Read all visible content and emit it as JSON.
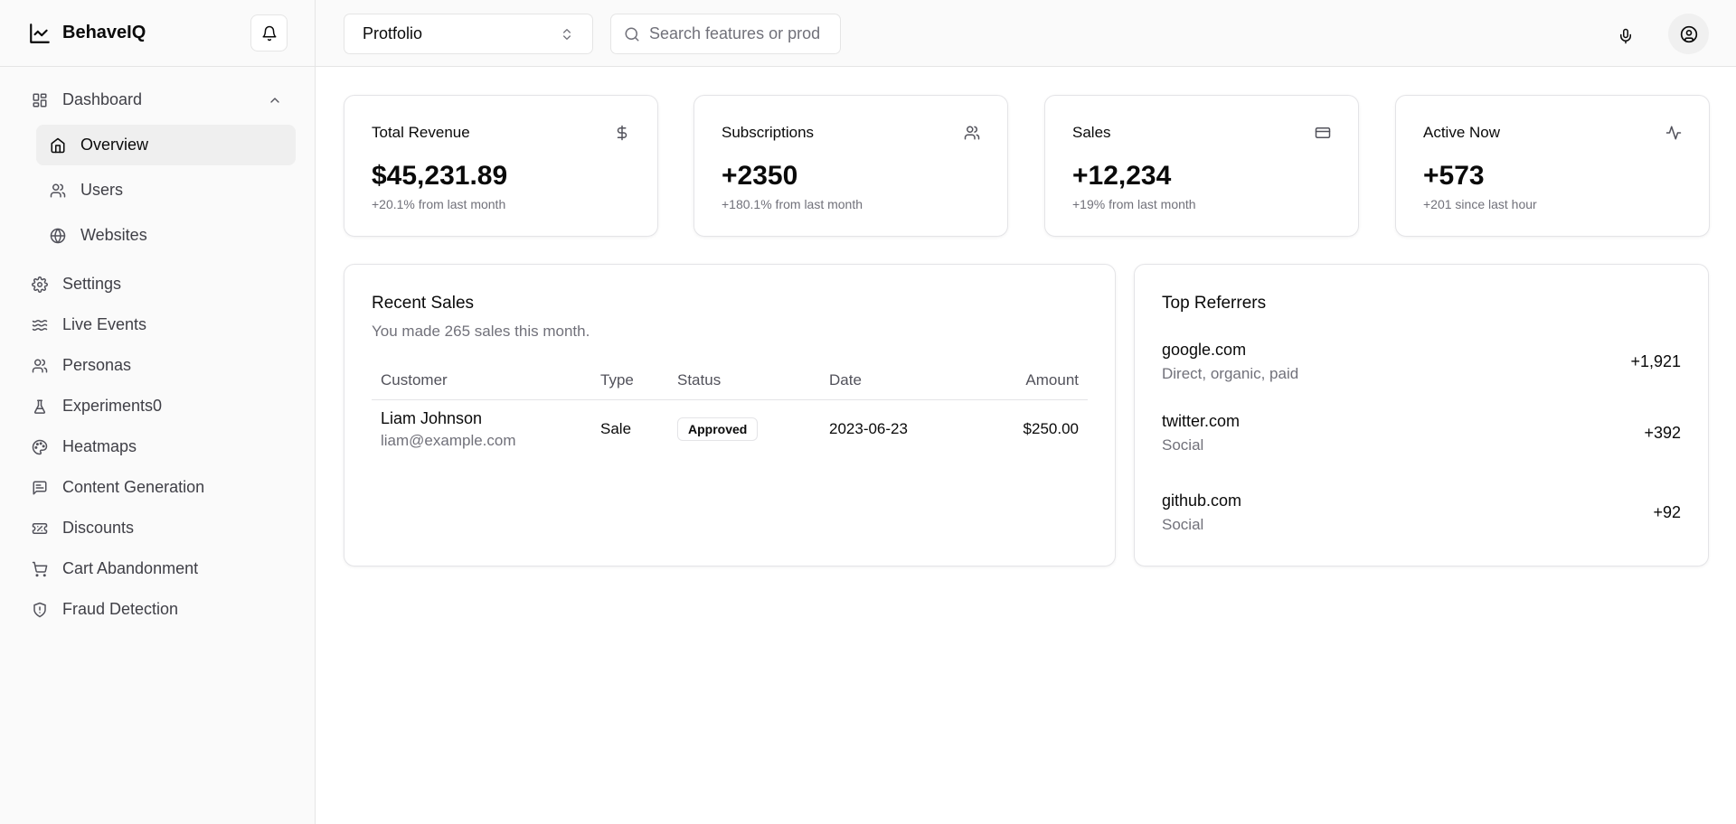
{
  "app": {
    "brand": "BehaveIQ"
  },
  "sidebar": {
    "items": [
      {
        "label": "Dashboard"
      },
      {
        "label": "Settings"
      },
      {
        "label": "Live Events"
      },
      {
        "label": "Personas"
      },
      {
        "label": "Experiments0"
      },
      {
        "label": "Heatmaps"
      },
      {
        "label": "Content Generation"
      },
      {
        "label": "Discounts"
      },
      {
        "label": "Cart Abandonment"
      },
      {
        "label": "Fraud Detection"
      }
    ],
    "subitems": [
      {
        "label": "Overview",
        "active": true
      },
      {
        "label": "Users"
      },
      {
        "label": "Websites"
      }
    ]
  },
  "topbar": {
    "project_select": "Protfolio",
    "search_placeholder": "Search features or prod"
  },
  "stats": [
    {
      "title": "Total Revenue",
      "value": "$45,231.89",
      "note": "+20.1% from last month",
      "icon": "dollar-icon"
    },
    {
      "title": "Subscriptions",
      "value": "+2350",
      "note": "+180.1% from last month",
      "icon": "users-icon"
    },
    {
      "title": "Sales",
      "value": "+12,234",
      "note": "+19% from last month",
      "icon": "credit-card-icon"
    },
    {
      "title": "Active Now",
      "value": "+573",
      "note": "+201 since last hour",
      "icon": "activity-icon"
    }
  ],
  "recent_sales": {
    "title": "Recent Sales",
    "subtitle": "You made 265 sales this month.",
    "columns": [
      "Customer",
      "Type",
      "Status",
      "Date",
      "Amount"
    ],
    "rows": [
      {
        "name": "Liam Johnson",
        "email": "liam@example.com",
        "type": "Sale",
        "status": "Approved",
        "date": "2023-06-23",
        "amount": "$250.00"
      }
    ]
  },
  "top_referrers": {
    "title": "Top Referrers",
    "items": [
      {
        "name": "google.com",
        "desc": "Direct, organic, paid",
        "value": "+1,921"
      },
      {
        "name": "twitter.com",
        "desc": "Social",
        "value": "+392"
      },
      {
        "name": "github.com",
        "desc": "Social",
        "value": "+92"
      }
    ]
  }
}
